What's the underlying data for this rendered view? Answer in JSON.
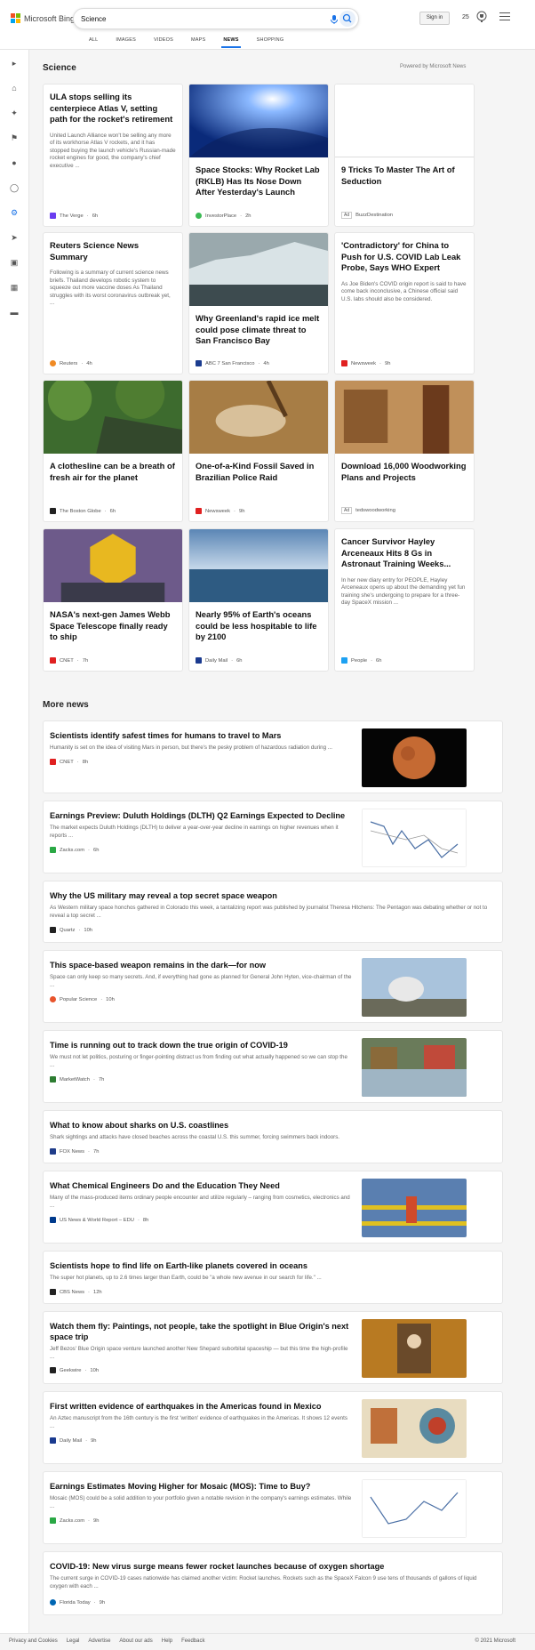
{
  "header": {
    "logo_text": "Microsoft Bing",
    "search_value": "Science",
    "sign_in": "Sign in",
    "points": "25"
  },
  "tabs": [
    "ALL",
    "IMAGES",
    "VIDEOS",
    "MAPS",
    "NEWS",
    "SHOPPING"
  ],
  "active_tab": "NEWS",
  "section": {
    "title": "Science",
    "powered_by": "Powered by Microsoft News"
  },
  "cards": [
    {
      "title": "ULA stops selling its centerpiece Atlas V, setting path for the rocket's retirement",
      "snippet": "United Launch Alliance won't be selling any more of its workhorse Atlas V rockets, and it has stopped buying the launch vehicle's Russian-made rocket engines for good, the company's chief executive ...",
      "source": "The Verge",
      "time": "6h"
    },
    {
      "title": "Space Stocks: Why Rocket Lab (RKLB) Has Its Nose Down After Yesterday's Launch",
      "source": "InvestorPlace",
      "time": "2h"
    },
    {
      "title": "9 Tricks To Master The Art of Seduction",
      "ad": "Ad",
      "source": "BuzzDestination"
    },
    {
      "title": "Reuters Science News Summary",
      "snippet": "Following is a summary of current science news briefs. Thailand develops robotic system to squeeze out more vaccine doses As Thailand struggles with its worst coronavirus outbreak yet, ...",
      "source": "Reuters",
      "time": "4h"
    },
    {
      "title": "Why Greenland's rapid ice melt could pose climate threat to San Francisco Bay",
      "source": "ABC 7 San Francisco",
      "time": "4h"
    },
    {
      "title": "'Contradictory' for China to Push for U.S. COVID Lab Leak Probe, Says WHO Expert",
      "snippet": "As Joe Biden's COVID origin report is said to have come back inconclusive, a Chinese official said U.S. labs should also be considered.",
      "source": "Newsweek",
      "time": "9h"
    },
    {
      "title": "A clothesline can be a breath of fresh air for the planet",
      "source": "The Boston Globe",
      "time": "6h"
    },
    {
      "title": "One-of-a-Kind Fossil Saved in Brazilian Police Raid",
      "source": "Newsweek",
      "time": "9h"
    },
    {
      "title": "Download 16,000 Woodworking Plans and Projects",
      "ad": "Ad",
      "source": "tedswoodworking"
    },
    {
      "title": "NASA's next-gen James Webb Space Telescope finally ready to ship",
      "source": "CNET",
      "time": "7h"
    },
    {
      "title": "Nearly 95% of Earth's oceans could be less hospitable to life by 2100",
      "source": "Daily Mail",
      "time": "6h"
    },
    {
      "title": "Cancer Survivor Hayley Arceneaux Hits 8 Gs in Astronaut Training Weeks...",
      "snippet": "In her new diary entry for PEOPLE, Hayley Arceneaux opens up about the demanding yet fun training she's undergoing to prepare for a three-day SpaceX mission ...",
      "source": "People",
      "time": "6h"
    }
  ],
  "more_news": {
    "title": "More news",
    "items": [
      {
        "title": "Scientists identify safest times for humans to travel to Mars",
        "snippet": "Humanity is set on the idea of visiting Mars in person, but there's the pesky problem of hazardous radiation during ...",
        "source": "CNET",
        "time": "8h"
      },
      {
        "title": "Earnings Preview: Duluth Holdings (DLTH) Q2 Earnings Expected to Decline",
        "snippet": "The market expects Duluth Holdings (DLTH) to deliver a year-over-year decline in earnings on higher revenues when it reports ...",
        "source": "Zacks.com",
        "time": "6h"
      },
      {
        "title": "Why the US military may reveal a top secret space weapon",
        "snippet": "As Western military space honchos gathered in Colorado this week, a tantalizing report was published by journalist Theresa Hitchens: The Pentagon was debating whether or not to reveal a top secret ...",
        "source": "Quartz",
        "time": "10h"
      },
      {
        "title": "This space-based weapon remains in the dark—for now",
        "snippet": "Space can only keep so many secrets. And, if everything had gone as planned for General John Hyten, vice-chairman of the ...",
        "source": "Popular Science",
        "time": "10h"
      },
      {
        "title": "Time is running out to track down the true origin of COVID-19",
        "snippet": "We must not let politics, posturing or finger-pointing distract us from finding out what actually happened so we can stop the ...",
        "source": "MarketWatch",
        "time": "7h"
      },
      {
        "title": "What to know about sharks on U.S. coastlines",
        "snippet": "Shark sightings and attacks have closed beaches across the coastal U.S. this summer, forcing swimmers back indoors.",
        "source": "FOX News",
        "time": "7h"
      },
      {
        "title": "What Chemical Engineers Do and the Education They Need",
        "snippet": "Many of the mass-produced items ordinary people encounter and utilize regularly – ranging from cosmetics, electronics and ...",
        "source": "US News & World Report – EDU",
        "time": "8h"
      },
      {
        "title": "Scientists hope to find life on Earth-like planets covered in oceans",
        "snippet": "The super hot planets, up to 2.6 times larger than Earth, could be \"a whole new avenue in our search for life.\" ...",
        "source": "CBS News",
        "time": "12h"
      },
      {
        "title": "Watch them fly: Paintings, not people, take the spotlight in Blue Origin's next space trip",
        "snippet": "Jeff Bezos' Blue Origin space venture launched another New Shepard suborbital spaceship — but this time the high-profile ...",
        "source": "Geekwire",
        "time": "10h"
      },
      {
        "title": "First written evidence of earthquakes in the Americas found in Mexico",
        "snippet": "An Aztec manuscript from the 16th century is the first 'written' evidence of earthquakes in the Americas. It shows 12 events ...",
        "source": "Daily Mail",
        "time": "9h"
      },
      {
        "title": "Earnings Estimates Moving Higher for Mosaic (MOS): Time to Buy?",
        "snippet": "Mosaic (MOS) could be a solid addition to your portfolio given a notable revision in the company's earnings estimates. While ...",
        "source": "Zacks.com",
        "time": "9h"
      },
      {
        "title": "COVID-19: New virus surge means fewer rocket launches because of oxygen shortage",
        "snippet": "The current surge in COVID-19 cases nationwide has claimed another victim: Rocket launches. Rockets such as the SpaceX Falcon 9 use tens of thousands of gallons of liquid oxygen with each ...",
        "source": "Florida Today",
        "time": "9h"
      }
    ]
  },
  "footer": {
    "links": [
      "Privacy and Cookies",
      "Legal",
      "Advertise",
      "About our ads",
      "Help",
      "Feedback"
    ],
    "copyright": "© 2021 Microsoft"
  },
  "colors": {
    "accent": "#1a73e8",
    "page_bg": "#f5f5f5",
    "card_bg": "#ffffff"
  }
}
